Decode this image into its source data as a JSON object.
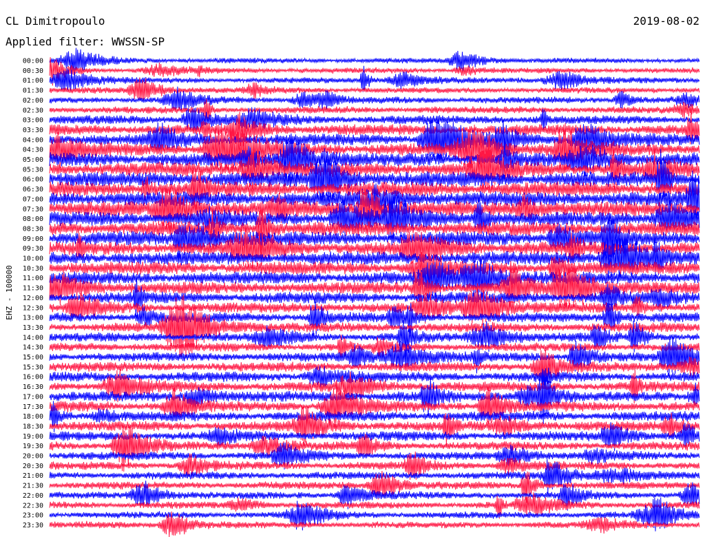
{
  "chart_data": {
    "type": "line",
    "title": "CL Dimitropoulo",
    "subtitle": "Applied filter: WWSSN-SP",
    "date": "2019-08-02",
    "ylabel": "EHZ - 100000",
    "xlabel": "",
    "grid": false,
    "legend": "none",
    "colors": [
      "#0000ff",
      "#ff1744"
    ],
    "traces": [
      {
        "label": "00:00",
        "activity": 0.18
      },
      {
        "label": "00:30",
        "activity": 0.2
      },
      {
        "label": "01:00",
        "activity": 0.22
      },
      {
        "label": "01:30",
        "activity": 0.25
      },
      {
        "label": "02:00",
        "activity": 0.3
      },
      {
        "label": "02:30",
        "activity": 0.35
      },
      {
        "label": "03:00",
        "activity": 0.5
      },
      {
        "label": "03:30",
        "activity": 0.65
      },
      {
        "label": "04:00",
        "activity": 0.75
      },
      {
        "label": "04:30",
        "activity": 0.85
      },
      {
        "label": "05:00",
        "activity": 0.9
      },
      {
        "label": "05:30",
        "activity": 0.95
      },
      {
        "label": "06:00",
        "activity": 1.0
      },
      {
        "label": "06:30",
        "activity": 1.0
      },
      {
        "label": "07:00",
        "activity": 1.0
      },
      {
        "label": "07:30",
        "activity": 1.0
      },
      {
        "label": "08:00",
        "activity": 0.95
      },
      {
        "label": "08:30",
        "activity": 0.95
      },
      {
        "label": "09:00",
        "activity": 0.92
      },
      {
        "label": "09:30",
        "activity": 0.9
      },
      {
        "label": "10:00",
        "activity": 0.88
      },
      {
        "label": "10:30",
        "activity": 0.85
      },
      {
        "label": "11:00",
        "activity": 0.8
      },
      {
        "label": "11:30",
        "activity": 0.75
      },
      {
        "label": "12:00",
        "activity": 0.7
      },
      {
        "label": "12:30",
        "activity": 0.62
      },
      {
        "label": "13:00",
        "activity": 0.58
      },
      {
        "label": "13:30",
        "activity": 0.55
      },
      {
        "label": "14:00",
        "activity": 0.52
      },
      {
        "label": "14:30",
        "activity": 0.5
      },
      {
        "label": "15:00",
        "activity": 0.52
      },
      {
        "label": "15:30",
        "activity": 0.55
      },
      {
        "label": "16:00",
        "activity": 0.58
      },
      {
        "label": "16:30",
        "activity": 0.6
      },
      {
        "label": "17:00",
        "activity": 0.62
      },
      {
        "label": "17:30",
        "activity": 0.62
      },
      {
        "label": "18:00",
        "activity": 0.6
      },
      {
        "label": "18:30",
        "activity": 0.58
      },
      {
        "label": "19:00",
        "activity": 0.55
      },
      {
        "label": "19:30",
        "activity": 0.5
      },
      {
        "label": "20:00",
        "activity": 0.45
      },
      {
        "label": "20:30",
        "activity": 0.42
      },
      {
        "label": "21:00",
        "activity": 0.4
      },
      {
        "label": "21:30",
        "activity": 0.38
      },
      {
        "label": "22:00",
        "activity": 0.36
      },
      {
        "label": "22:30",
        "activity": 0.34
      },
      {
        "label": "23:00",
        "activity": 0.32
      },
      {
        "label": "23:30",
        "activity": 0.3
      }
    ]
  }
}
